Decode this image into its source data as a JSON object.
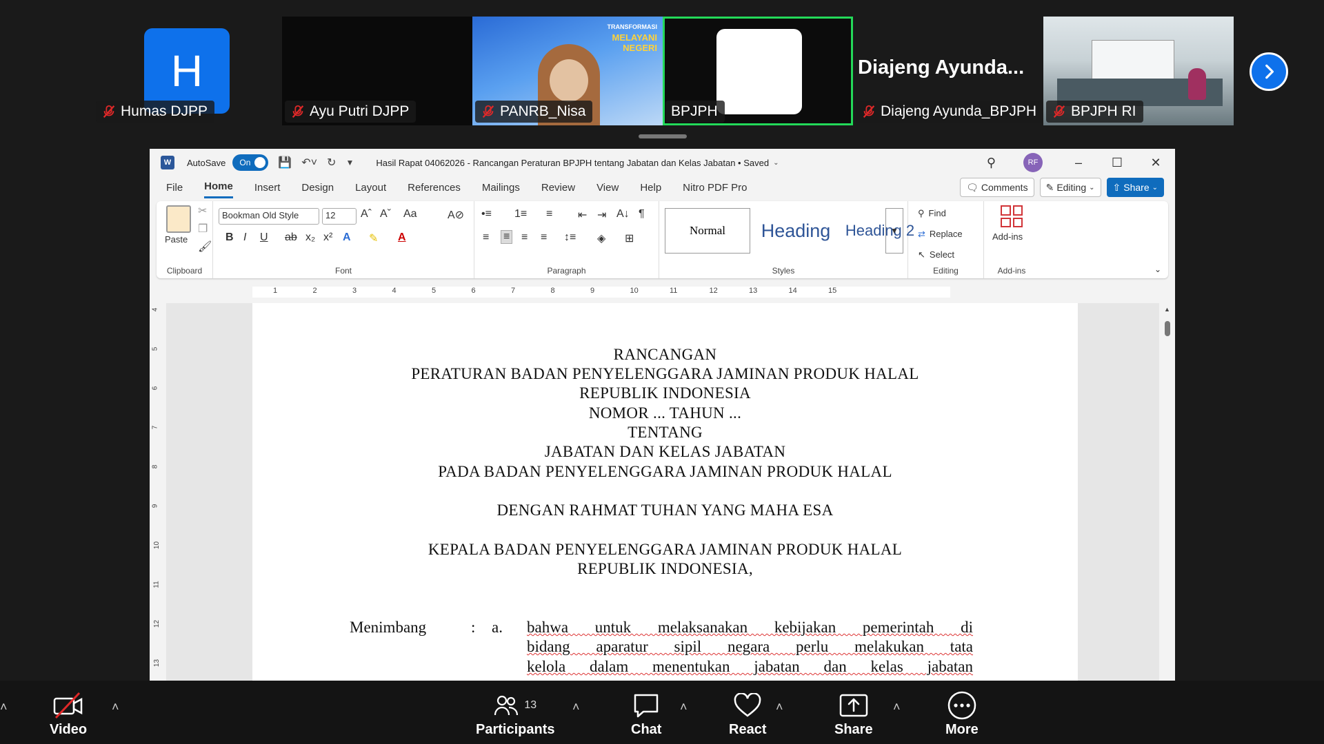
{
  "gallery": {
    "tiles": [
      {
        "name": "Humas DJPP",
        "avatar_letter": "H"
      },
      {
        "name": "Ayu Putri DJPP"
      },
      {
        "name": "PANRB_Nisa",
        "banner_line1": "TRANSFORMASI",
        "banner_line2": "MELAYANI",
        "banner_line3": "NEGERI"
      },
      {
        "name": "BPJPH"
      },
      {
        "name": "Diajeng Ayunda_BPJPH",
        "display_title": "Diajeng  Ayunda..."
      },
      {
        "name": "BPJPH RI"
      }
    ],
    "next_icon": "chevron-right-icon"
  },
  "word": {
    "autosave_label": "AutoSave",
    "autosave_state": "On",
    "doc_title": "Hasil Rapat 04062026 - Rancangan Peraturan BPJPH tentang Jabatan dan Kelas Jabatan • Saved",
    "user_initials": "RF",
    "menu_tabs": [
      "File",
      "Home",
      "Insert",
      "Design",
      "Layout",
      "References",
      "Mailings",
      "Review",
      "View",
      "Help",
      "Nitro PDF Pro"
    ],
    "comments_label": "Comments",
    "editing_label": "Editing",
    "share_label": "Share",
    "ribbon": {
      "paste_label": "Paste",
      "clipboard_label": "Clipboard",
      "font_name": "Bookman Old Style",
      "font_size": "12",
      "font_label": "Font",
      "paragraph_label": "Paragraph",
      "styles": [
        "Normal",
        "Heading",
        "Heading 2"
      ],
      "styles_label": "Styles",
      "find_label": "Find",
      "replace_label": "Replace",
      "select_label": "Select",
      "editing_group_label": "Editing",
      "addins_label": "Add-ins",
      "addins_group_label": "Add-ins"
    },
    "ruler_numbers": [
      "1",
      "2",
      "3",
      "4",
      "5",
      "6",
      "7",
      "8",
      "9",
      "10",
      "11",
      "12",
      "13",
      "14",
      "15"
    ],
    "vruler_numbers": [
      "4",
      "5",
      "6",
      "7",
      "8",
      "9",
      "10",
      "11",
      "12",
      "13"
    ],
    "document": {
      "lines": [
        "RANCANGAN",
        "PERATURAN BADAN PENYELENGGARA JAMINAN PRODUK HALAL",
        "REPUBLIK INDONESIA",
        "NOMOR ... TAHUN ...",
        "TENTANG",
        "JABATAN DAN KELAS JABATAN",
        "PADA BADAN PENYELENGGARA JAMINAN PRODUK HALAL",
        "DENGAN RAHMAT TUHAN YANG MAHA ESA",
        "KEPALA BADAN PENYELENGGARA JAMINAN PRODUK HALAL",
        "REPUBLIK INDONESIA,"
      ],
      "menimbang_label": "Menimbang",
      "colon": ":",
      "item_letter": "a.",
      "body_lines": [
        "bahwa untuk melaksanakan kebijakan pemerintah di",
        "bidang aparatur sipil negara perlu melakukan tata",
        "kelola dalam menentukan jabatan dan kelas jabatan"
      ]
    }
  },
  "controls": {
    "video_label": "Video",
    "participants_label": "Participants",
    "participants_count": "13",
    "chat_label": "Chat",
    "react_label": "React",
    "share_label": "Share",
    "more_label": "More"
  },
  "colors": {
    "zoom_blue": "#0e71eb",
    "active_speaker_border": "#23d959",
    "word_blue": "#0f6cbd"
  }
}
